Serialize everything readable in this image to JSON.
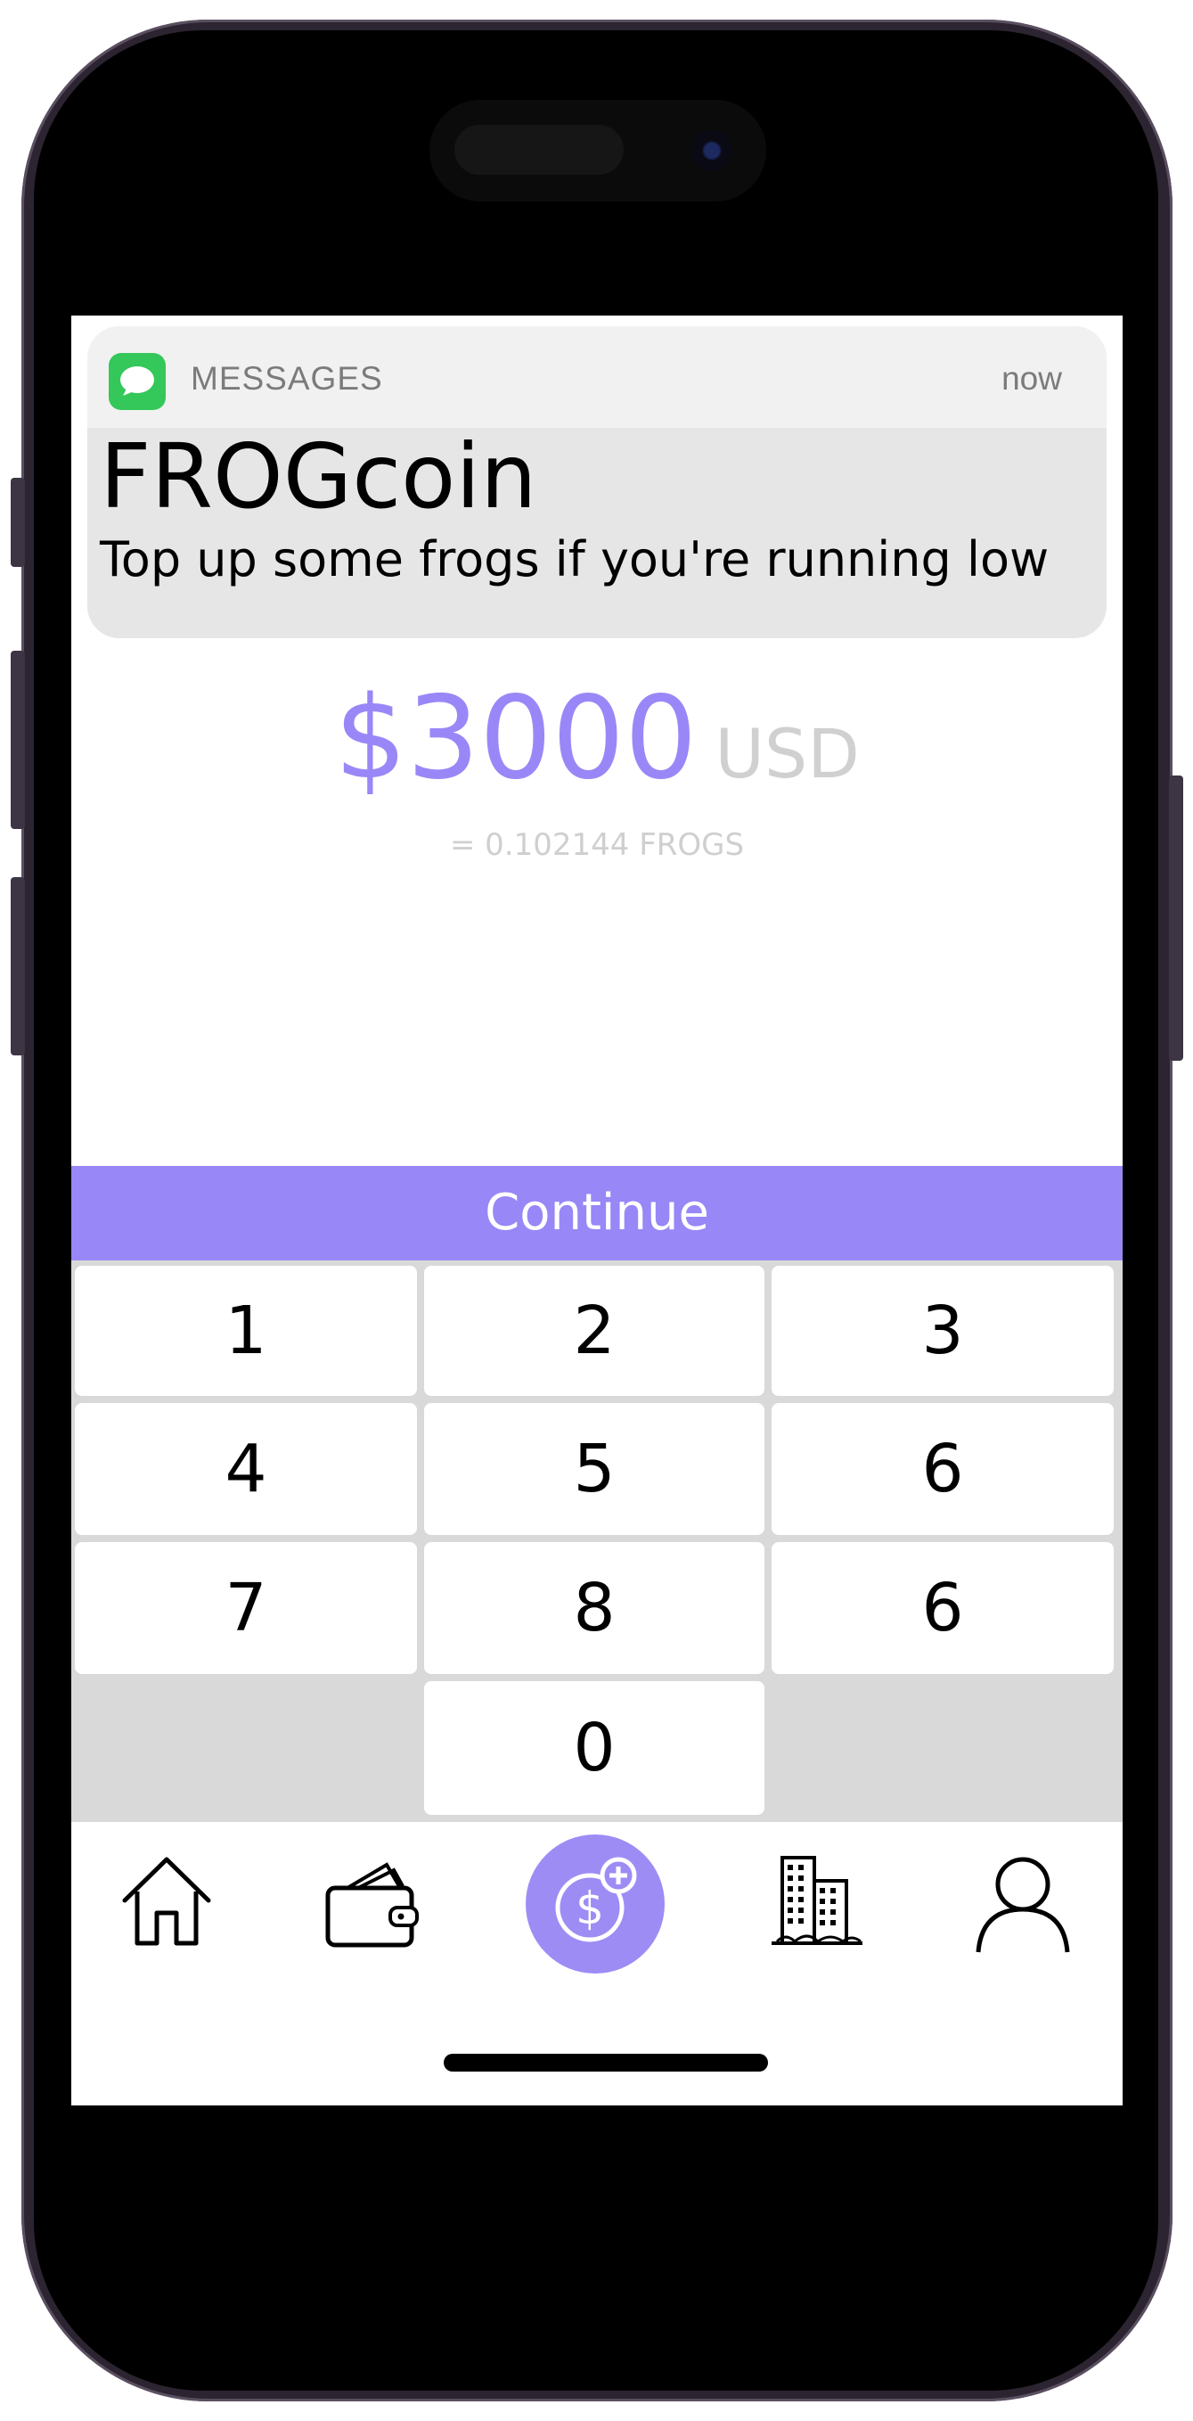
{
  "notification": {
    "app_name": "MESSAGES",
    "time": "now",
    "title": "FROGcoin",
    "body": "Top up some frogs if you're running low",
    "app_icon": "messages-bubble-icon"
  },
  "amount": {
    "value": "$3000",
    "currency": "USD",
    "conversion": "= 0.102144 FROGS"
  },
  "continue_label": "Continue",
  "keypad": {
    "keys": [
      "1",
      "2",
      "3",
      "4",
      "5",
      "6",
      "7",
      "8",
      "6",
      "0"
    ]
  },
  "tabbar": {
    "items": [
      "home-icon",
      "wallet-icon",
      "add-funds-icon",
      "buildings-icon",
      "profile-icon"
    ]
  },
  "colors": {
    "accent": "#9787f7",
    "amount": "#9a87f7",
    "currency_gray": "#d0d0d0",
    "keypad_bg": "#d9d9d9",
    "messages_green": "#34c759"
  }
}
